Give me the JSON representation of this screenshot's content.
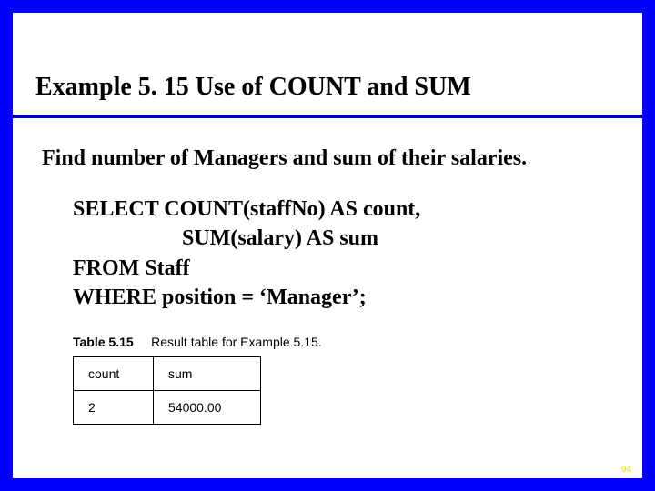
{
  "title": "Example 5. 15  Use of COUNT and SUM",
  "subtitle": "Find number of Managers and sum of their salaries.",
  "code": {
    "line1": "SELECT COUNT(staffNo) AS count,",
    "line2": "SUM(salary) AS sum",
    "line3": "FROM Staff",
    "line4": "WHERE position = ‘Manager’;"
  },
  "table": {
    "caption_label": "Table 5.15",
    "caption_text": "Result table for Example 5.15.",
    "headers": {
      "col1": "count",
      "col2": "sum"
    },
    "row": {
      "count": "2",
      "sum": "54000.00"
    }
  },
  "page_number": "94"
}
